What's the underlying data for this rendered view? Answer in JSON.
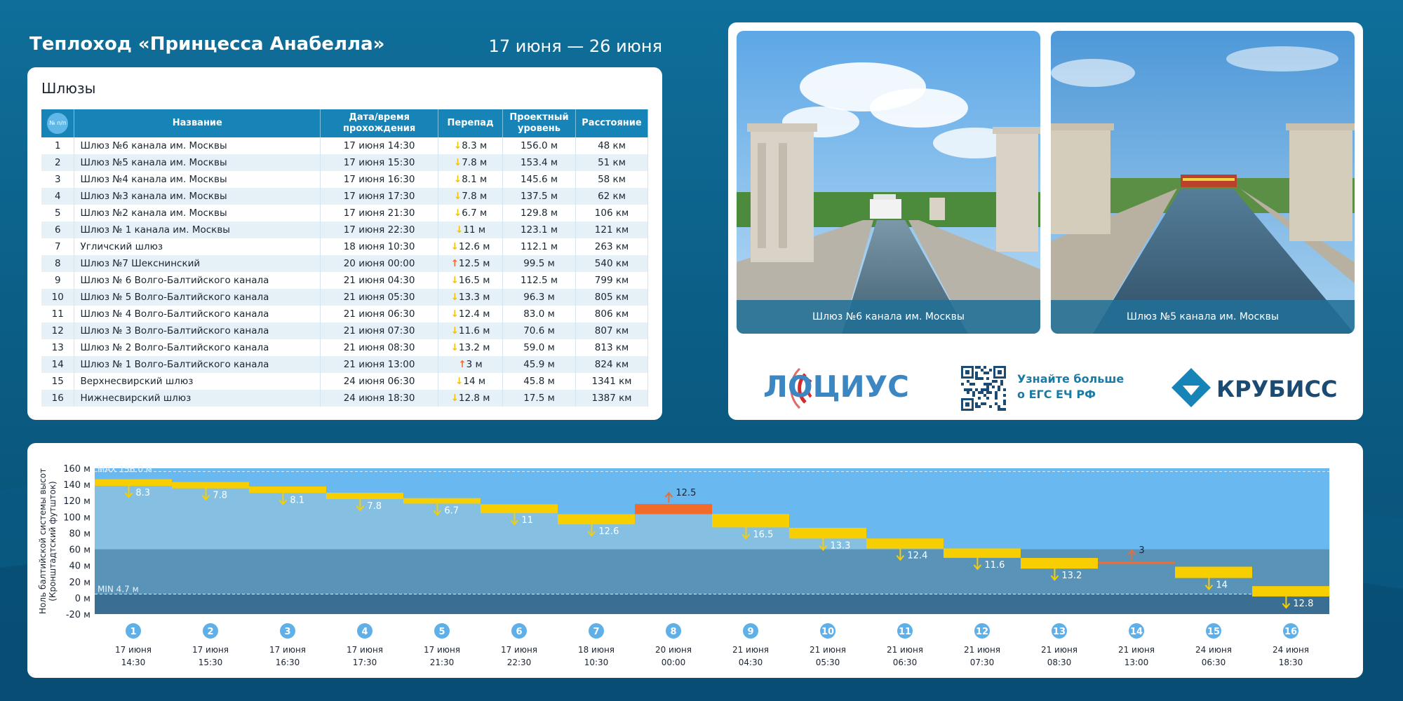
{
  "header": {
    "title": "Теплоход «Принцесса Анабелла»",
    "dates": "17 июня — 26 июня"
  },
  "locks_table": {
    "title": "Шлюзы",
    "columns": {
      "num": "№ п/п",
      "name": "Название",
      "datetime": "Дата/время прохождения",
      "drop": "Перепад",
      "level": "Проектный уровень",
      "distance": "Расстояние"
    },
    "rows": [
      {
        "num": "1",
        "name": "Шлюз №6 канала им. Москвы",
        "datetime": "17 июня 14:30",
        "dir": "down",
        "drop": "8.3 м",
        "level": "156.0 м",
        "distance": "48 км"
      },
      {
        "num": "2",
        "name": "Шлюз №5 канала им. Москвы",
        "datetime": "17 июня 15:30",
        "dir": "down",
        "drop": "7.8 м",
        "level": "153.4 м",
        "distance": "51 км"
      },
      {
        "num": "3",
        "name": "Шлюз №4 канала им. Москвы",
        "datetime": "17 июня 16:30",
        "dir": "down",
        "drop": "8.1 м",
        "level": "145.6 м",
        "distance": "58 км"
      },
      {
        "num": "4",
        "name": "Шлюз №3 канала им. Москвы",
        "datetime": "17 июня 17:30",
        "dir": "down",
        "drop": "7.8 м",
        "level": "137.5 м",
        "distance": "62 км"
      },
      {
        "num": "5",
        "name": "Шлюз №2 канала им. Москвы",
        "datetime": "17 июня 21:30",
        "dir": "down",
        "drop": "6.7 м",
        "level": "129.8 м",
        "distance": "106 км"
      },
      {
        "num": "6",
        "name": "Шлюз № 1 канала им. Москвы",
        "datetime": "17 июня 22:30",
        "dir": "down",
        "drop": "11 м",
        "level": "123.1 м",
        "distance": "121 км"
      },
      {
        "num": "7",
        "name": "Угличский шлюз",
        "datetime": "18 июня 10:30",
        "dir": "down",
        "drop": "12.6 м",
        "level": "112.1 м",
        "distance": "263 км"
      },
      {
        "num": "8",
        "name": "Шлюз №7 Шекснинский",
        "datetime": "20 июня 00:00",
        "dir": "up",
        "drop": "12.5 м",
        "level": "99.5 м",
        "distance": "540 км"
      },
      {
        "num": "9",
        "name": "Шлюз № 6 Волго-Балтийского канала",
        "datetime": "21 июня 04:30",
        "dir": "down",
        "drop": "16.5 м",
        "level": "112.5 м",
        "distance": "799 км"
      },
      {
        "num": "10",
        "name": "Шлюз № 5 Волго-Балтийского канала",
        "datetime": "21 июня 05:30",
        "dir": "down",
        "drop": "13.3 м",
        "level": "96.3 м",
        "distance": "805 км"
      },
      {
        "num": "11",
        "name": "Шлюз № 4 Волго-Балтийского канала",
        "datetime": "21 июня 06:30",
        "dir": "down",
        "drop": "12.4 м",
        "level": "83.0 м",
        "distance": "806 км"
      },
      {
        "num": "12",
        "name": "Шлюз № 3 Волго-Балтийского канала",
        "datetime": "21 июня 07:30",
        "dir": "down",
        "drop": "11.6 м",
        "level": "70.6 м",
        "distance": "807 км"
      },
      {
        "num": "13",
        "name": "Шлюз № 2 Волго-Балтийского канала",
        "datetime": "21 июня 08:30",
        "dir": "down",
        "drop": "13.2 м",
        "level": "59.0 м",
        "distance": "813 км"
      },
      {
        "num": "14",
        "name": "Шлюз № 1 Волго-Балтийского канала",
        "datetime": "21 июня 13:00",
        "dir": "up",
        "drop": "3 м",
        "level": "45.9 м",
        "distance": "824 км"
      },
      {
        "num": "15",
        "name": "Верхнесвирский шлюз",
        "datetime": "24 июня 06:30",
        "dir": "down",
        "drop": "14 м",
        "level": "45.8 м",
        "distance": "1341 км"
      },
      {
        "num": "16",
        "name": "Нижнесвирский шлюз",
        "datetime": "24 июня 18:30",
        "dir": "down",
        "drop": "12.8 м",
        "level": "17.5 м",
        "distance": "1387 км"
      }
    ]
  },
  "photos": [
    {
      "caption": "Шлюз №6 канала им. Москвы"
    },
    {
      "caption": "Шлюз №5 канала им. Москвы"
    }
  ],
  "logos": {
    "lotsius": "ЛОЦИУС",
    "qr_text_line1": "Узнайте больше",
    "qr_text_line2": "о ЕГС ЕЧ РФ",
    "krubiss": "КРУБИСС"
  },
  "icons": {
    "down_arrow": "arrow-down-icon",
    "up_arrow": "arrow-up-icon"
  },
  "colors": {
    "accent": "#1784b8",
    "down": "#f3c200",
    "up": "#f26b2a",
    "chart_sky": "#6ab8f0"
  },
  "chart_data": {
    "type": "step",
    "ylabel_line1": "Ноль балтийской системы высот",
    "ylabel_line2": "(Кронштадтский футшток)",
    "yticks": [
      "160 м",
      "140 м",
      "120 м",
      "100 м",
      "80 м",
      "60 м",
      "40 м",
      "20 м",
      "0 м",
      "-20 м"
    ],
    "ylim": [
      -20,
      160
    ],
    "max_label": "MAX 156.0 м",
    "min_label": "MIN 4.7 м",
    "max_value": 156.0,
    "min_value": 4.7,
    "steps": [
      {
        "n": "1",
        "level": 146.5,
        "drop": 8.3,
        "dir": "down",
        "label": "8.3",
        "date": "17 июня",
        "time": "14:30"
      },
      {
        "n": "2",
        "level": 143.0,
        "drop": 7.8,
        "dir": "down",
        "label": "7.8",
        "date": "17 июня",
        "time": "15:30"
      },
      {
        "n": "3",
        "level": 137.5,
        "drop": 8.1,
        "dir": "down",
        "label": "8.1",
        "date": "17 июня",
        "time": "16:30"
      },
      {
        "n": "4",
        "level": 129.8,
        "drop": 7.8,
        "dir": "down",
        "label": "7.8",
        "date": "17 июня",
        "time": "17:30"
      },
      {
        "n": "5",
        "level": 123.1,
        "drop": 6.7,
        "dir": "down",
        "label": "6.7",
        "date": "17 июня",
        "time": "21:30"
      },
      {
        "n": "6",
        "level": 115.5,
        "drop": 11,
        "dir": "down",
        "label": "11",
        "date": "17 июня",
        "time": "22:30"
      },
      {
        "n": "7",
        "level": 103.3,
        "drop": 12.6,
        "dir": "down",
        "label": "12.6",
        "date": "18 июня",
        "time": "10:30"
      },
      {
        "n": "8",
        "level": 103.4,
        "drop": 12.5,
        "dir": "up",
        "label": "12.5",
        "date": "20 июня",
        "time": "00:00"
      },
      {
        "n": "9",
        "level": 103.5,
        "drop": 16.5,
        "dir": "down",
        "label": "16.5",
        "date": "21 июня",
        "time": "04:30"
      },
      {
        "n": "10",
        "level": 86.5,
        "drop": 13.3,
        "dir": "down",
        "label": "13.3",
        "date": "21 июня",
        "time": "05:30"
      },
      {
        "n": "11",
        "level": 73.3,
        "drop": 12.4,
        "dir": "down",
        "label": "12.4",
        "date": "21 июня",
        "time": "06:30"
      },
      {
        "n": "12",
        "level": 61.0,
        "drop": 11.6,
        "dir": "down",
        "label": "11.6",
        "date": "21 июня",
        "time": "07:30"
      },
      {
        "n": "13",
        "level": 49.3,
        "drop": 13.2,
        "dir": "down",
        "label": "13.2",
        "date": "21 июня",
        "time": "08:30"
      },
      {
        "n": "14",
        "level": 42.0,
        "drop": 3,
        "dir": "up",
        "label": "3",
        "date": "21 июня",
        "time": "13:00"
      },
      {
        "n": "15",
        "level": 38.5,
        "drop": 14,
        "dir": "down",
        "label": "14",
        "date": "24 июня",
        "time": "06:30"
      },
      {
        "n": "16",
        "level": 14.5,
        "drop": 12.8,
        "dir": "down",
        "label": "12.8",
        "date": "24 июня",
        "time": "18:30"
      }
    ]
  }
}
